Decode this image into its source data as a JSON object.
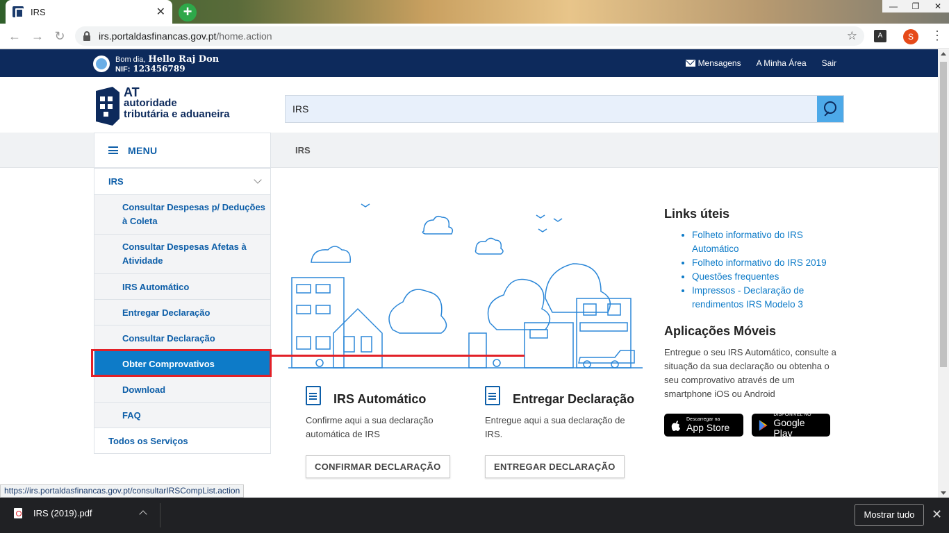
{
  "browser": {
    "tab_title": "IRS",
    "tab_close": "✕",
    "new_tab": "+",
    "url_host": "irs.portaldasfinancas.gov.pt",
    "url_path": "/home.action",
    "profile_initial": "S",
    "window_controls": [
      "—",
      "❐",
      "✕"
    ]
  },
  "topbar": {
    "greeting": "Bom dia,",
    "user_name": "Hello Raj Don",
    "nif_label": "NIF:",
    "nif": "123456789",
    "links": [
      "Mensagens",
      "A Minha Área",
      "Sair"
    ]
  },
  "header": {
    "logo_line1": "AT",
    "logo_line2": "autoridade",
    "logo_line3": "tributária e aduaneira",
    "search_value": "IRS"
  },
  "menu": {
    "label": "MENU",
    "breadcrumb": "IRS"
  },
  "sidebar": {
    "section": "IRS",
    "items": [
      "Consultar Despesas p/ Deduções à Coleta",
      "Consultar Despesas Afetas à Atividade",
      "IRS Automático",
      "Entregar Declaração",
      "Consultar Declaração",
      "Obter Comprovativos",
      "Download",
      "FAQ"
    ],
    "all_services": "Todos os Serviços"
  },
  "cards": [
    {
      "title": "IRS Automático",
      "text": "Confirme aqui a sua declaração automática de IRS",
      "button": "CONFIRMAR DECLARAÇÃO"
    },
    {
      "title": "Entregar Declaração",
      "text": "Entregue aqui a sua declaração de IRS.",
      "button": "ENTREGAR DECLARAÇÃO"
    }
  ],
  "links_uteis": {
    "title": "Links úteis",
    "items": [
      "Folheto informativo do IRS Automático",
      "Folheto informativo do IRS 2019",
      "Questões frequentes",
      "Impressos - Declaração de rendimentos IRS Modelo 3"
    ]
  },
  "apps": {
    "title": "Aplicações Móveis",
    "text": "Entregue o seu IRS Automático, consulte a situação da sua declaração ou obtenha o seu comprovativo através de um smartphone iOS ou Android",
    "appstore_small": "Descarregar na",
    "appstore_big": "App Store",
    "gplay_small": "DISPONÍVEL NO",
    "gplay_big": "Google Play"
  },
  "status_url": "https://irs.portaldasfinancas.gov.pt/consultarIRSCompList.action",
  "downloads": {
    "file": "IRS (2019).pdf",
    "show_all": "Mostrar tudo",
    "close": "✕"
  },
  "colors": {
    "brand_navy": "#0d2a5c",
    "link_blue": "#0d7bc8",
    "active_blue": "#0d7bc8",
    "annotation_red": "#e22027"
  }
}
